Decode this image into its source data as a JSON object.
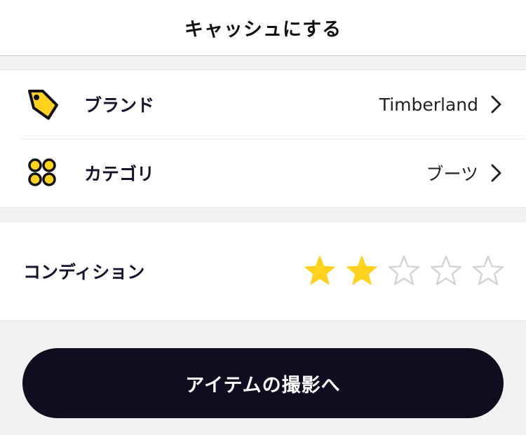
{
  "header": {
    "title": "キャッシュにする"
  },
  "details": {
    "brand": {
      "label": "ブランド",
      "value": "Timberland",
      "icon": "tag-icon"
    },
    "category": {
      "label": "カテゴリ",
      "value": "ブーツ",
      "icon": "grid-dots-icon"
    }
  },
  "condition": {
    "label": "コンディション",
    "rating": 2,
    "max": 5
  },
  "cta": {
    "label": "アイテムの撮影へ"
  },
  "colors": {
    "accent_yellow": "#ffd21e",
    "star_empty": "#d4d4d8",
    "cta_bg": "#0e0e20"
  }
}
